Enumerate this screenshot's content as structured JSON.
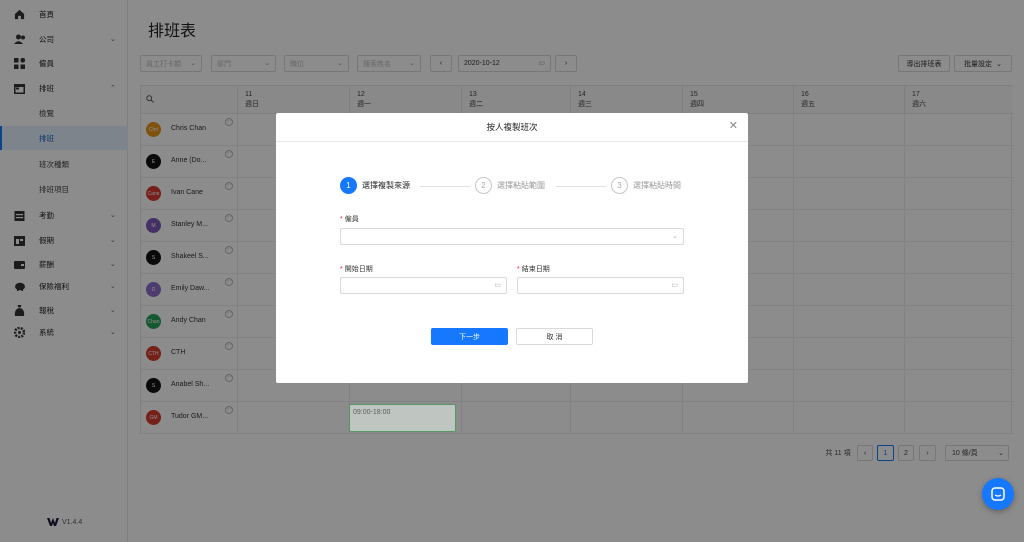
{
  "sidebar": {
    "items": [
      {
        "label": "首頁",
        "icon": "home-icon"
      },
      {
        "label": "公司",
        "icon": "users-icon",
        "chevron": "⌄"
      },
      {
        "label": "僱員",
        "icon": "grid-icon"
      },
      {
        "label": "排班",
        "icon": "calendar-icon",
        "chevron": "⌃"
      },
      {
        "label": "檢覽"
      },
      {
        "label": "排班"
      },
      {
        "label": "班次種類"
      },
      {
        "label": "排班項目"
      },
      {
        "label": "考勤",
        "icon": "clipboard-icon",
        "chevron": "⌄"
      },
      {
        "label": "假期",
        "icon": "holiday-icon",
        "chevron": "⌄"
      },
      {
        "label": "薪酬",
        "icon": "wallet-icon",
        "chevron": "⌄"
      },
      {
        "label": "保險福利",
        "icon": "piggy-icon",
        "chevron": "⌄"
      },
      {
        "label": "報稅",
        "icon": "money-bag-icon",
        "chevron": "⌄"
      },
      {
        "label": "系統",
        "icon": "gear-icon",
        "chevron": "⌄"
      }
    ],
    "version": "V1.4.4"
  },
  "page": {
    "title": "排班表",
    "filters": {
      "type_placeholder": "員工打卡類",
      "dept_placeholder": "部門",
      "position_placeholder": "職位",
      "search_placeholder": "搜索姓名",
      "date": "2020-10-12"
    },
    "export_button": "導出排班表",
    "batch_button": "批量設定"
  },
  "table": {
    "columns": [
      {
        "day": "11",
        "weekday": "週日"
      },
      {
        "day": "12",
        "weekday": "週一"
      },
      {
        "day": "13",
        "weekday": "週二"
      },
      {
        "day": "14",
        "weekday": "週三"
      },
      {
        "day": "15",
        "weekday": "週四"
      },
      {
        "day": "16",
        "weekday": "週五"
      },
      {
        "day": "17",
        "weekday": "週六"
      }
    ],
    "employees": [
      {
        "name": "Chris Chan",
        "avatar_text": "Chri",
        "avatar_color": "#e8951c"
      },
      {
        "name": "Anne (Do...",
        "avatar_text": "E",
        "avatar_color": "#111111"
      },
      {
        "name": "Ivan Cane",
        "avatar_text": "Cane",
        "avatar_color": "#d63b2c"
      },
      {
        "name": "Stanley M...",
        "avatar_text": "M",
        "avatar_color": "#7b5ab8"
      },
      {
        "name": "Shakeel S...",
        "avatar_text": "S",
        "avatar_color": "#111111"
      },
      {
        "name": "Emily Daw...",
        "avatar_text": "D",
        "avatar_color": "#8c6fc9"
      },
      {
        "name": "Andy Chan",
        "avatar_text": "Chan",
        "avatar_color": "#26a25a"
      },
      {
        "name": "CTH",
        "avatar_text": "CTH",
        "avatar_color": "#d63b2c"
      },
      {
        "name": "Anabel Sh...",
        "avatar_text": "S",
        "avatar_color": "#111111"
      },
      {
        "name": "Tudor GM...",
        "avatar_text": "GM",
        "avatar_color": "#d63b2c"
      }
    ],
    "shift_label": "09:00-18:00"
  },
  "pagination": {
    "total": "共 11 項",
    "pages": [
      "1",
      "2"
    ],
    "page_size": "10 條/頁"
  },
  "modal": {
    "title": "按人複製班次",
    "steps": [
      {
        "num": "1",
        "label": "選擇複製來源"
      },
      {
        "num": "2",
        "label": "選擇粘貼範圍"
      },
      {
        "num": "3",
        "label": "選擇粘貼時間"
      }
    ],
    "employee_label": "僱員",
    "start_label": "開始日期",
    "end_label": "結束日期",
    "next_button": "下一步",
    "cancel_button": "取 消"
  },
  "colors": {
    "primary": "#1677ff",
    "shift_border": "#28a745"
  }
}
